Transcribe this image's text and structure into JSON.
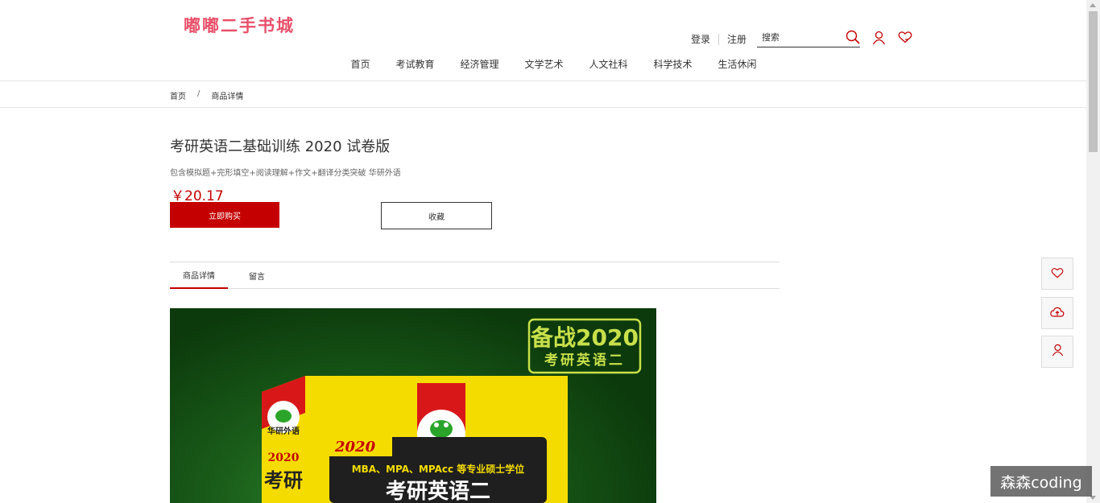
{
  "header": {
    "logo_text": "嘟嘟二手书城",
    "login": "登录",
    "register": "注册",
    "search_placeholder": "搜索"
  },
  "nav": {
    "items": [
      "首页",
      "考试教育",
      "经济管理",
      "文学艺术",
      "人文社科",
      "科学技术",
      "生活休闲"
    ]
  },
  "breadcrumb": {
    "home": "首页",
    "separator": "/",
    "current": "商品详情"
  },
  "product": {
    "title": "考研英语二基础训练 2020 试卷版",
    "subtitle": "包含模拟题+完形填空+阅读理解+作文+翻译分类突破 华研外语",
    "price": "￥20.17",
    "buy_label": "立即购买",
    "fav_label": "收藏"
  },
  "tabs": {
    "detail": "商品详情",
    "comment": "留言"
  },
  "cover": {
    "badge_line1": "备战2020",
    "badge_line2": "考研英语二",
    "publisher": "华研外语",
    "year": "2020",
    "series_line": "MBA、MPA、MPAcc 等专业硕士学位",
    "book_title": "考研英语二",
    "spine_text": "考研"
  },
  "watermark": "森森coding",
  "colors": {
    "accent": "#c40000",
    "logo": "#e8506a"
  }
}
